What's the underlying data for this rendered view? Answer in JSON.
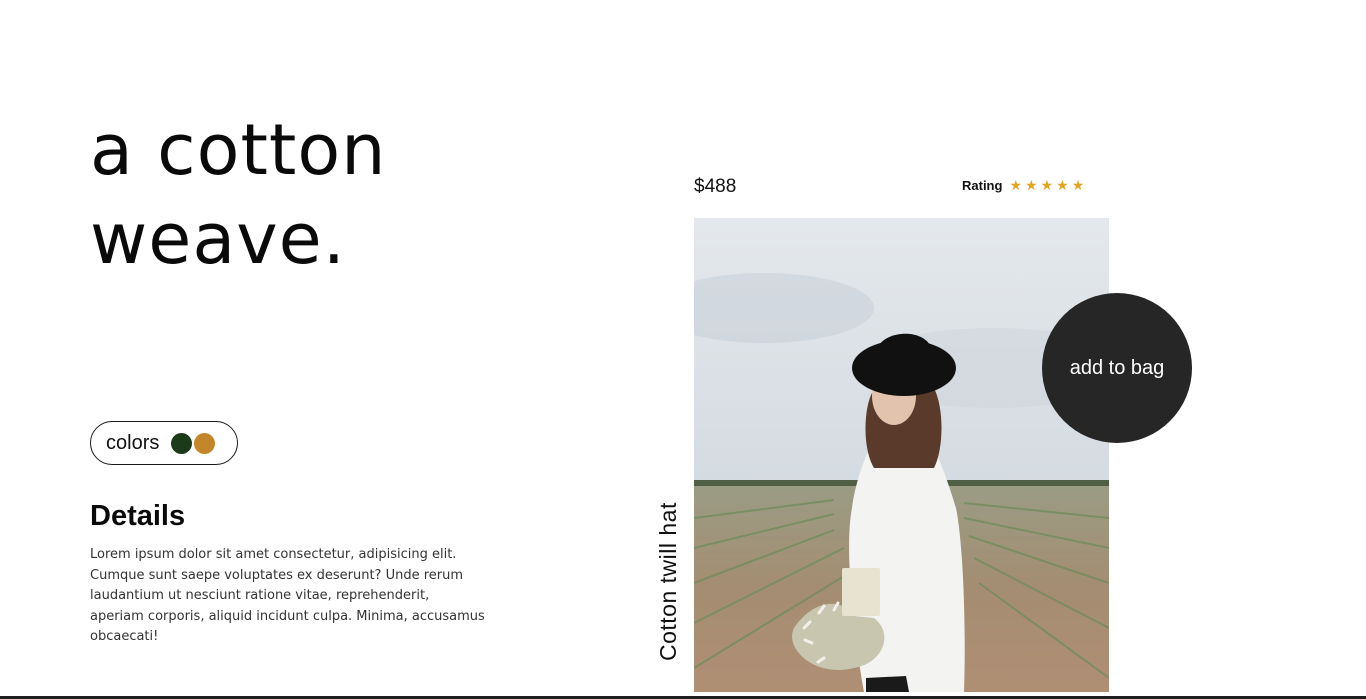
{
  "headline": {
    "line1": "a cotton",
    "line2": "weave."
  },
  "colors": {
    "label": "colors",
    "swatches": [
      {
        "name": "dark-green",
        "hex": "#1b3a1a"
      },
      {
        "name": "ochre",
        "hex": "#c4862b"
      }
    ]
  },
  "details": {
    "title": "Details",
    "text": "Lorem ipsum dolor sit amet consectetur, adipisicing elit. Cumque sunt saepe voluptates ex deserunt? Unde rerum laudantium ut nesciunt ratione vitae, reprehenderit, aperiam corporis, aliquid incidunt culpa. Minima, accusamus obcaecati!"
  },
  "product": {
    "price": "$488",
    "rating_label": "Rating",
    "rating_value": 5,
    "rating_max": 5,
    "star_color": "#e0a526",
    "name": "Cotton twill hat"
  },
  "cta": {
    "label": "add to bag",
    "bg": "#262626"
  }
}
